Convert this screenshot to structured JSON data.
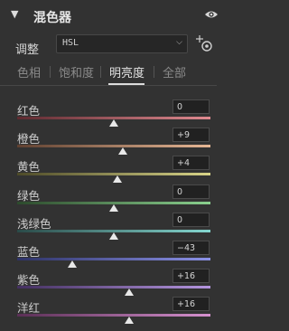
{
  "panel": {
    "title": "混色器"
  },
  "mode": {
    "label": "调整",
    "value": "HSL"
  },
  "tabs": [
    {
      "label": "色相",
      "active": false
    },
    {
      "label": "饱和度",
      "active": false
    },
    {
      "label": "明亮度",
      "active": true
    },
    {
      "label": "全部",
      "active": false
    }
  ],
  "sliders": [
    {
      "label": "红色",
      "value": "0",
      "amount": 0,
      "gradient": [
        "#5e2a30",
        "#e08a90"
      ]
    },
    {
      "label": "橙色",
      "value": "+9",
      "amount": 9,
      "gradient": [
        "#5f4030",
        "#e7b795"
      ]
    },
    {
      "label": "黄色",
      "value": "+4",
      "amount": 4,
      "gradient": [
        "#4d4a28",
        "#d8d488"
      ]
    },
    {
      "label": "绿色",
      "value": "0",
      "amount": 0,
      "gradient": [
        "#2c4a2c",
        "#8ad08e"
      ]
    },
    {
      "label": "浅绿色",
      "value": "0",
      "amount": 0,
      "gradient": [
        "#2a4a48",
        "#84d6cf"
      ]
    },
    {
      "label": "蓝色",
      "value": "−43",
      "amount": -43,
      "gradient": [
        "#2d3266",
        "#8c92e8"
      ]
    },
    {
      "label": "紫色",
      "value": "+16",
      "amount": 16,
      "gradient": [
        "#432f60",
        "#b596e0"
      ]
    },
    {
      "label": "洋红",
      "value": "+16",
      "amount": 16,
      "gradient": [
        "#5a2e55",
        "#d691cf"
      ]
    }
  ]
}
